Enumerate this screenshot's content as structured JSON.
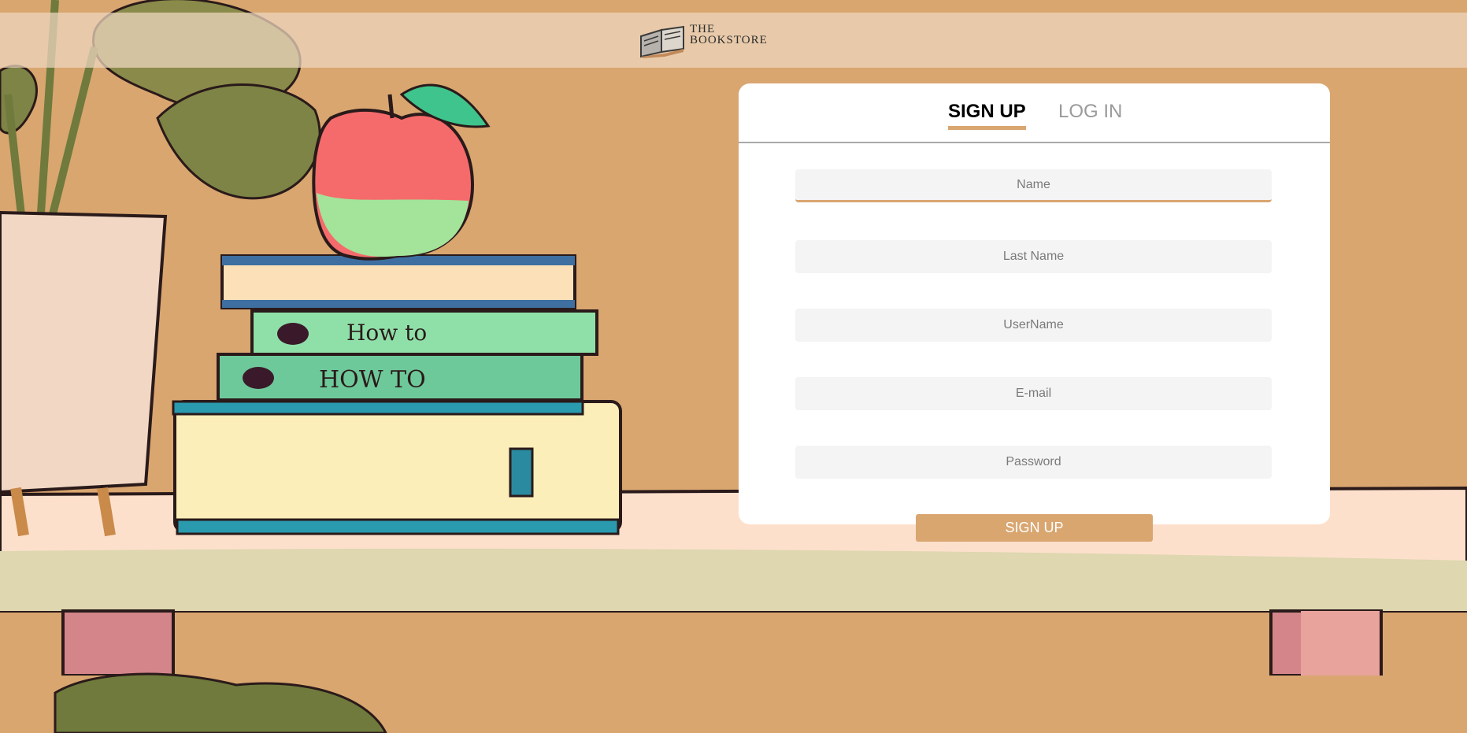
{
  "header": {
    "logo_line1": "THE",
    "logo_line2": "BOOKSTORE"
  },
  "tabs": [
    {
      "label": "SIGN UP",
      "active": true
    },
    {
      "label": "LOG IN",
      "active": false
    }
  ],
  "form": {
    "name": {
      "placeholder": "Name",
      "value": ""
    },
    "last_name": {
      "placeholder": "Last Name",
      "value": ""
    },
    "username": {
      "placeholder": "UserName",
      "value": ""
    },
    "email": {
      "placeholder": "E-mail",
      "value": ""
    },
    "password": {
      "placeholder": "Password",
      "value": ""
    },
    "submit_label": "SIGN UP"
  },
  "colors": {
    "accent": "#d9a670",
    "card": "#ffffff",
    "field": "#f4f4f4"
  },
  "book_spines": {
    "book_2": "HOW TO",
    "book_3": "How to"
  }
}
